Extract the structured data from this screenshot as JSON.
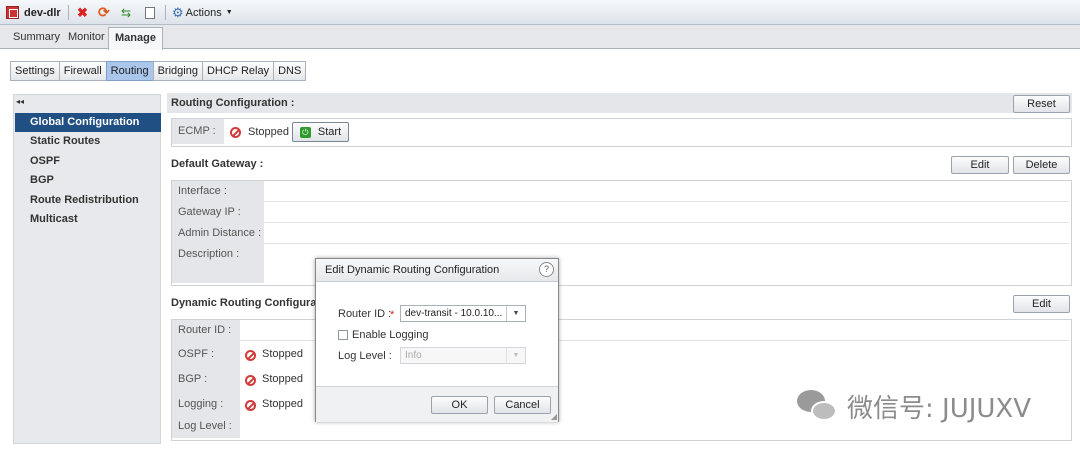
{
  "toolbar": {
    "title": "dev-dlr",
    "actions_label": "Actions"
  },
  "main_tabs": [
    "Summary",
    "Monitor",
    "Manage"
  ],
  "sub_tabs": [
    "Settings",
    "Firewall",
    "Routing",
    "Bridging",
    "DHCP Relay",
    "DNS"
  ],
  "nav": {
    "collapse_glyph": "◂◂",
    "items": [
      "Global Configuration",
      "Static Routes",
      "OSPF",
      "BGP",
      "Route Redistribution",
      "Multicast"
    ]
  },
  "routing_config": {
    "title": "Routing Configuration :",
    "reset_label": "Reset",
    "ecmp_label": "ECMP :",
    "ecmp_status": "Stopped",
    "start_label": "Start"
  },
  "default_gateway": {
    "title": "Default Gateway :",
    "edit_label": "Edit",
    "delete_label": "Delete",
    "rows": [
      "Interface :",
      "Gateway IP :",
      "Admin Distance :",
      "Description :"
    ]
  },
  "dynamic_routing": {
    "title": "Dynamic Routing Configuration :",
    "edit_label": "Edit",
    "router_id_label": "Router ID :",
    "ospf_label": "OSPF :",
    "ospf_status": "Stopped",
    "bgp_label": "BGP :",
    "bgp_status": "Stopped",
    "logging_label": "Logging :",
    "logging_status": "Stopped",
    "log_level_label": "Log Level :"
  },
  "modal": {
    "title": "Edit Dynamic Routing Configuration",
    "help_glyph": "?",
    "router_id_label": "Router ID :",
    "required_mark": "*",
    "router_id_value": "dev-transit - 10.0.10...",
    "enable_logging_label": "Enable Logging",
    "enable_logging_checked": false,
    "log_level_label": "Log Level :",
    "log_level_value": "Info",
    "ok_label": "OK",
    "cancel_label": "Cancel"
  },
  "watermark": {
    "text": "微信号: JUJUXV"
  },
  "colors": {
    "nav_active": "#1f4f83",
    "tab_active": "#aac6ea",
    "stopped_red": "#d23a3a",
    "start_green": "#2e9a2e"
  }
}
